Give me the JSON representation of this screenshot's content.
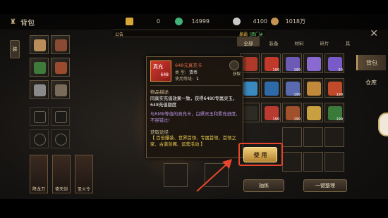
{
  "header": {
    "title": "背包",
    "resources": [
      {
        "icon": "gold-ingot-icon",
        "value": "0",
        "color": "#d8a73a"
      },
      {
        "icon": "jade-coin-icon",
        "value": "14999",
        "color": "#3fb37a"
      },
      {
        "icon": "silver-coin-icon",
        "value": "4100",
        "color": "#c8c8c8"
      },
      {
        "icon": "copper-coin-icon",
        "value": "1018万",
        "color": "#c59452"
      }
    ]
  },
  "notice": {
    "tag": "公告",
    "name": "暴霸",
    "location": "[西门#"
  },
  "left": {
    "side_tab": "装",
    "big_slots": [
      "降龙刀",
      "倚天剑",
      "圣火令"
    ]
  },
  "tooltip": {
    "icon_label": "真充",
    "icon_value": "648",
    "title": "648元真充卡",
    "type_label": "类    型:",
    "type_value": "货币",
    "level_label": "使用等级:",
    "level_value": "1",
    "source_button": "获取",
    "desc_header": "物品描述",
    "desc": "同真实充值效果一致，获得6480专属灵玉，648充值额度",
    "note": "与RMB等值的真充卡，白嫖灵玉和累充进度，不容错过!",
    "get_header": "获取途径",
    "get_text": "【 百倍爆装、世界首领、专属首领、首领之家、古道剑阁、运营活动 】"
  },
  "inventory": {
    "categories": [
      "全部",
      "装备",
      "材料",
      "碎片",
      "其"
    ],
    "counts": [
      "199",
      "199",
      "50",
      "199",
      "199",
      "199",
      "199",
      "199"
    ],
    "use_button": "使 用",
    "train_button": "抽炼",
    "sort_button": "一键整理"
  },
  "right_tabs": [
    "背包",
    "仓库"
  ]
}
